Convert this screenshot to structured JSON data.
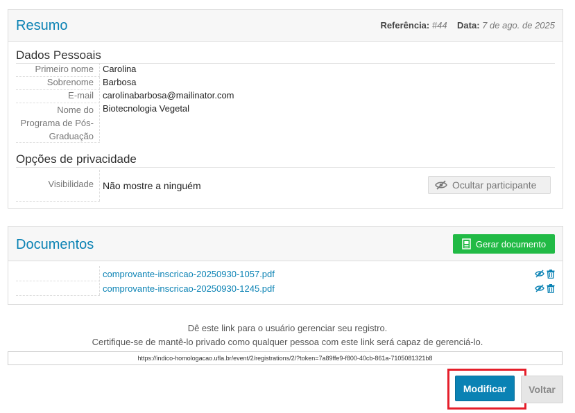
{
  "summary": {
    "title": "Resumo",
    "reference_label": "Referência:",
    "reference_value": "#44",
    "date_label": "Data:",
    "date_value": "7 de ago. de 2025"
  },
  "personal": {
    "heading": "Dados Pessoais",
    "fields": [
      {
        "label": "Primeiro nome",
        "value": "Carolina"
      },
      {
        "label": "Sobrenome",
        "value": "Barbosa"
      },
      {
        "label": "E-mail",
        "value": "carolinabarbosa@mailinator.com"
      },
      {
        "label_lines": [
          "Nome do",
          "Programa de Pós-",
          "Graduação"
        ],
        "value": "Biotecnologia Vegetal"
      }
    ]
  },
  "privacy": {
    "heading": "Opções de privacidade",
    "visibility_label": "Visibilidade",
    "visibility_value": "Não mostre a ninguém",
    "hide_button": "Ocultar participante"
  },
  "documents": {
    "title": "Documentos",
    "generate_button": "Gerar documento",
    "files": [
      "comprovante-inscricao-20250930-1057.pdf",
      "comprovante-inscricao-20250930-1245.pdf"
    ]
  },
  "manage": {
    "line1": "Dê este link para o usuário gerenciar seu registro.",
    "line2": "Certifique-se de mantê-lo privado como qualquer pessoa com este link será capaz de gerenciá-lo.",
    "link": "https://indico-homologacao.ufla.br/event/2/registrations/2/?token=7a89ffe9-f800-40cb-861a-7105081321b8"
  },
  "actions": {
    "modify": "Modificar",
    "back": "Voltar"
  },
  "colors": {
    "accent": "#0a82b4",
    "success": "#21ba45",
    "highlight": "#e51e2a"
  }
}
